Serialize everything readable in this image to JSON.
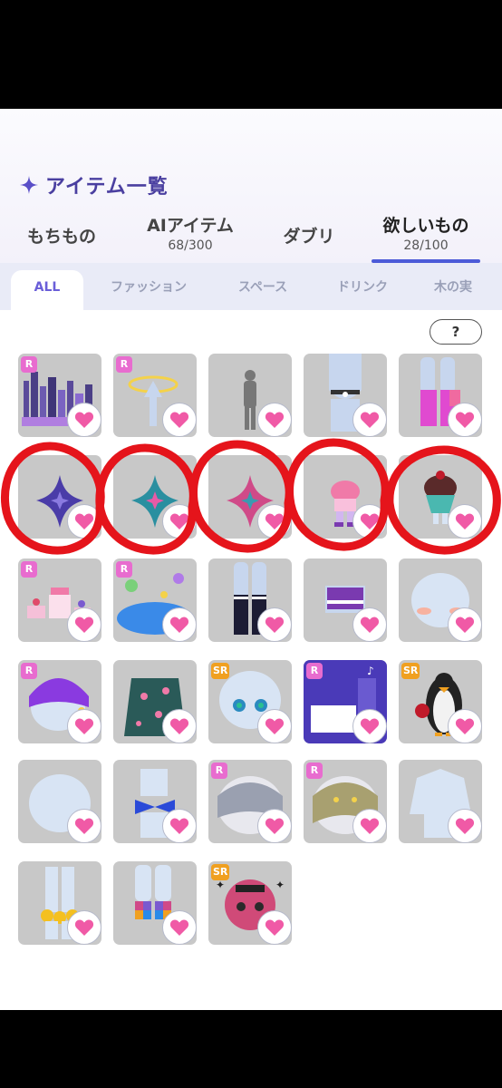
{
  "header": {
    "title": "アイテム一覧"
  },
  "tabs": [
    {
      "label": "もちもの",
      "count": ""
    },
    {
      "label": "AIアイテム",
      "count": "68/300"
    },
    {
      "label": "ダブリ",
      "count": ""
    },
    {
      "label": "欲しいもの",
      "count": "28/100"
    }
  ],
  "filters": [
    "ALL",
    "ファッション",
    "スペース",
    "ドリンク",
    "木の実"
  ],
  "help_label": "?",
  "items": [
    {
      "rarity": "R",
      "art": "city-skyline"
    },
    {
      "rarity": "R",
      "art": "halo-figure"
    },
    {
      "rarity": "",
      "art": "silhouette"
    },
    {
      "rarity": "",
      "art": "choker"
    },
    {
      "rarity": "",
      "art": "pink-socks"
    },
    {
      "rarity": "",
      "art": "purple-star"
    },
    {
      "rarity": "",
      "art": "teal-star"
    },
    {
      "rarity": "",
      "art": "pink-star"
    },
    {
      "rarity": "",
      "art": "pink-hat-doll"
    },
    {
      "rarity": "",
      "art": "chocolate-cupcake"
    },
    {
      "rarity": "R",
      "art": "cake-party"
    },
    {
      "rarity": "R",
      "art": "blue-planet-cushion"
    },
    {
      "rarity": "",
      "art": "black-socks"
    },
    {
      "rarity": "",
      "art": "purple-vest"
    },
    {
      "rarity": "",
      "art": "blush-face"
    },
    {
      "rarity": "R",
      "art": "purple-beanie"
    },
    {
      "rarity": "",
      "art": "starry-coat"
    },
    {
      "rarity": "SR",
      "art": "green-eyes"
    },
    {
      "rarity": "R",
      "art": "blue-room"
    },
    {
      "rarity": "SR",
      "art": "penguin"
    },
    {
      "rarity": "",
      "art": "plain-head"
    },
    {
      "rarity": "",
      "art": "blue-bow"
    },
    {
      "rarity": "R",
      "art": "silver-hair"
    },
    {
      "rarity": "R",
      "art": "golden-hair"
    },
    {
      "rarity": "",
      "art": "plain-shirt"
    },
    {
      "rarity": "",
      "art": "yellow-flower-legs"
    },
    {
      "rarity": "",
      "art": "pixel-socks"
    },
    {
      "rarity": "SR",
      "art": "pink-hair-face"
    }
  ],
  "colors": {
    "accent": "#4c5bd8",
    "heart": "#f05aa6",
    "r_badge": "#e86ccf",
    "sr_badge": "#f0a020",
    "circle": "#e5141b"
  }
}
